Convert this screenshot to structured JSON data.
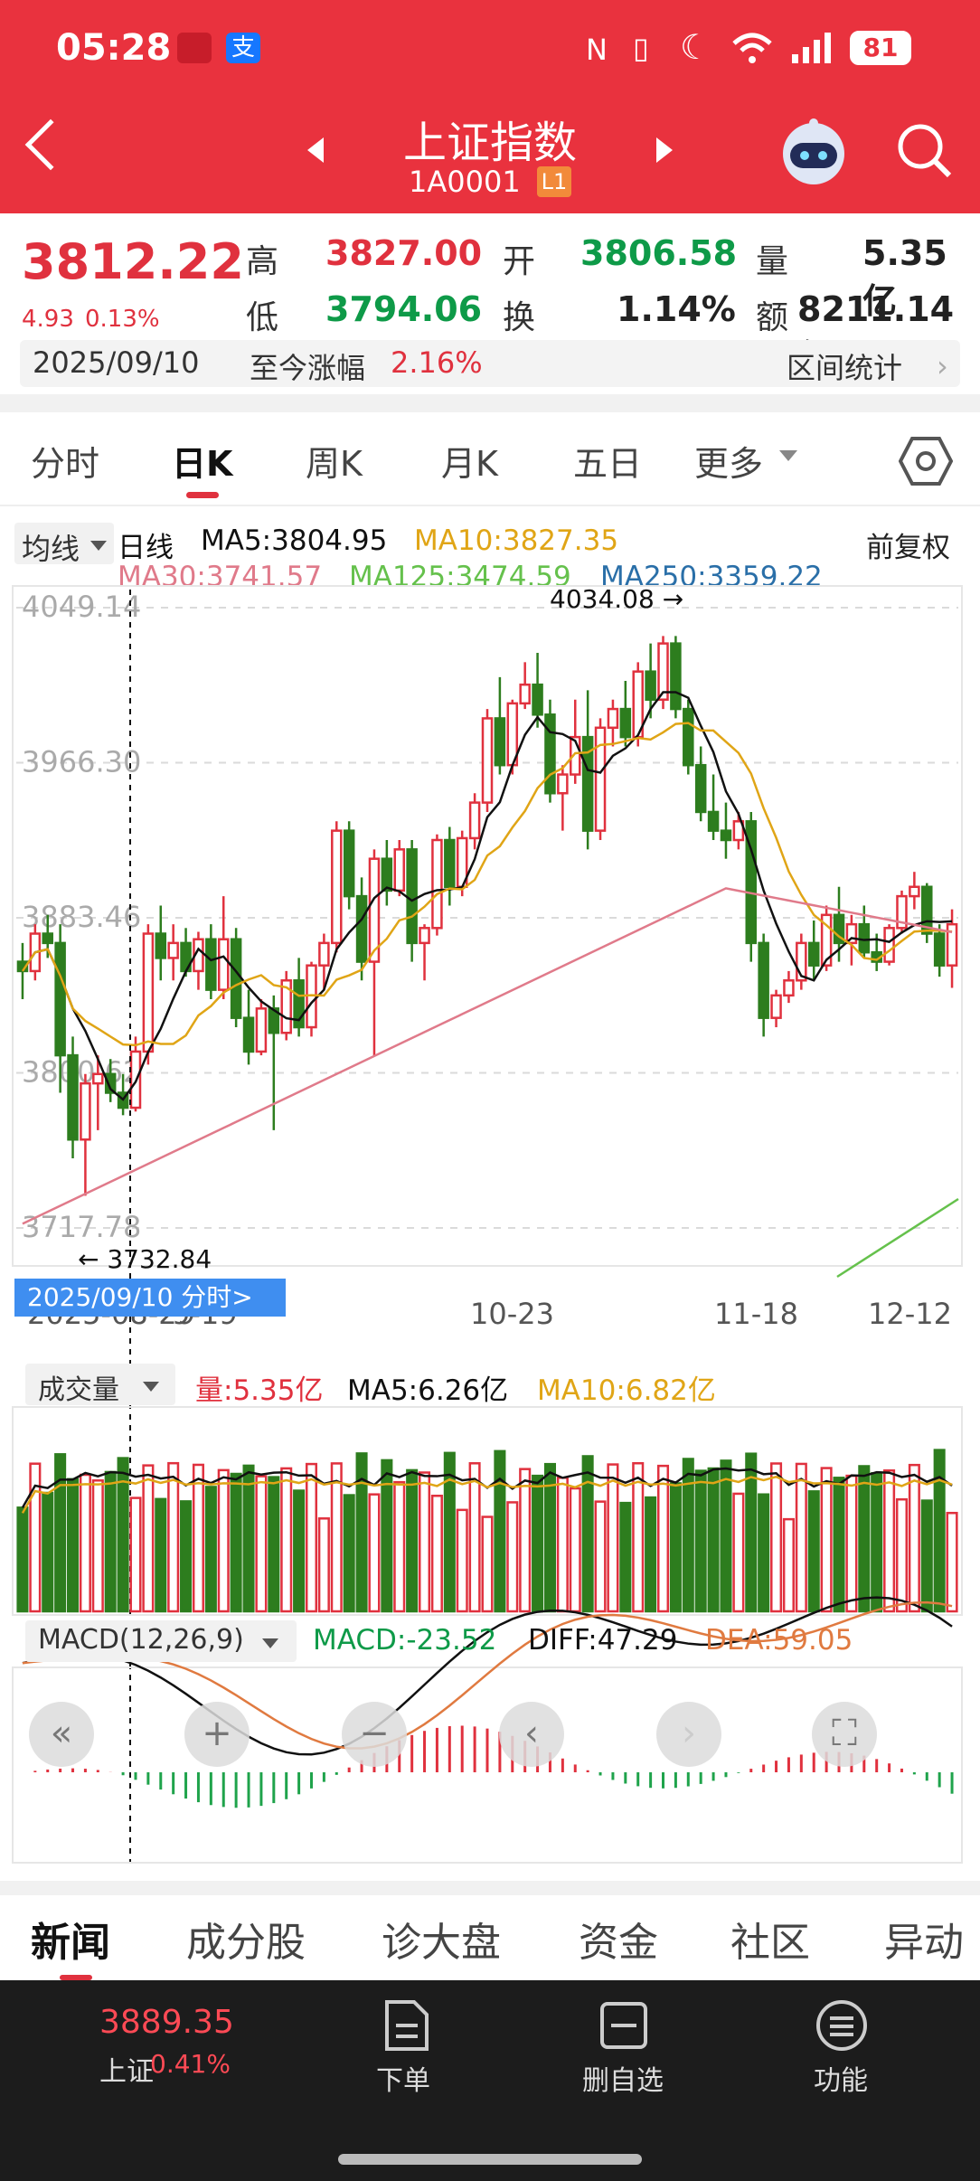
{
  "status_bar": {
    "time": "05:28",
    "battery": "81"
  },
  "header": {
    "title": "上证指数",
    "code": "1A0001",
    "level": "L1"
  },
  "quote": {
    "price": "3812.22",
    "change": "4.93",
    "change_pct": "0.13%",
    "high_label": "高",
    "high": "3827.00",
    "open_label": "开",
    "open": "3806.58",
    "vol_label": "量",
    "volume": "5.35亿",
    "low_label": "低",
    "low": "3794.06",
    "turnover_label": "换",
    "turnover": "1.14%",
    "amount_label": "额",
    "amount": "8211.14亿",
    "date": "2025/09/10",
    "since_label": "至今涨幅",
    "since_value": "2.16%",
    "range_stats": "区间统计"
  },
  "tabs": [
    "分时",
    "日K",
    "周K",
    "月K",
    "五日",
    "更多"
  ],
  "chart_controls": {
    "indicator_select": "均线",
    "period": "日线",
    "adjust": "前复权"
  },
  "ma_legend": {
    "ma5": "MA5:3804.95",
    "ma10": "MA10:3827.35",
    "ma30": "MA30:3741.57",
    "ma125": "MA125:3474.59",
    "ma250": "MA250:3359.22"
  },
  "y_ticks": [
    "4049.14",
    "3966.30",
    "3883.46",
    "3800.62",
    "3717.78"
  ],
  "high_label": "4034.08",
  "low_label": "3732.84",
  "x_ticks": [
    "2025-08-29",
    "9-19",
    "10-23",
    "11-18",
    "12-12"
  ],
  "cursor_label": "2025/09/10 分时>",
  "volume_legend": {
    "select": "成交量",
    "vol": "量:5.35亿",
    "ma5": "MA5:6.26亿",
    "ma10": "MA10:6.82亿"
  },
  "macd_legend": {
    "select": "MACD(12,26,9)",
    "macd": "MACD:-23.52",
    "diff": "DIFF:47.29",
    "dea": "DEA:59.05"
  },
  "news_tabs": [
    "新闻",
    "成分股",
    "诊大盘",
    "资金",
    "社区",
    "异动"
  ],
  "bottom_bar": {
    "index_value": "3889.35",
    "index_label": "上证",
    "index_pct": "0.41%",
    "order": "下单",
    "remove_watch": "删自选",
    "functions": "功能"
  },
  "colors": {
    "up": "#e0313e",
    "down": "#2d7d1e",
    "ma5": "#111111",
    "ma10": "#e0a516",
    "ma30": "#e07a8a",
    "ma125": "#65c14c",
    "ma250": "#2a6fa8",
    "header": "#e9323e"
  },
  "chart_data": {
    "type": "candlestick",
    "ylim": [
      3717.78,
      4049.14
    ],
    "candles": [
      [
        3860,
        3870,
        3840,
        3855
      ],
      [
        3855,
        3880,
        3850,
        3875
      ],
      [
        3875,
        3885,
        3862,
        3870
      ],
      [
        3870,
        3880,
        3790,
        3810
      ],
      [
        3810,
        3820,
        3755,
        3765
      ],
      [
        3765,
        3800,
        3735,
        3795
      ],
      [
        3795,
        3810,
        3770,
        3800
      ],
      [
        3800,
        3808,
        3785,
        3790
      ],
      [
        3790,
        3800,
        3778,
        3782
      ],
      [
        3782,
        3820,
        3780,
        3812
      ],
      [
        3812,
        3880,
        3805,
        3875
      ],
      [
        3875,
        3890,
        3850,
        3862
      ],
      [
        3862,
        3880,
        3850,
        3870
      ],
      [
        3870,
        3878,
        3852,
        3855
      ],
      [
        3855,
        3876,
        3845,
        3872
      ],
      [
        3872,
        3880,
        3840,
        3845
      ],
      [
        3845,
        3895,
        3840,
        3872
      ],
      [
        3872,
        3878,
        3825,
        3830
      ],
      [
        3830,
        3845,
        3805,
        3812
      ],
      [
        3812,
        3840,
        3810,
        3835
      ],
      [
        3835,
        3842,
        3770,
        3822
      ],
      [
        3822,
        3855,
        3818,
        3850
      ],
      [
        3850,
        3862,
        3820,
        3825
      ],
      [
        3825,
        3860,
        3820,
        3858
      ],
      [
        3858,
        3875,
        3845,
        3870
      ],
      [
        3870,
        3935,
        3865,
        3930
      ],
      [
        3930,
        3935,
        3888,
        3895
      ],
      [
        3895,
        3905,
        3850,
        3860
      ],
      [
        3860,
        3920,
        3810,
        3915
      ],
      [
        3915,
        3925,
        3890,
        3898
      ],
      [
        3898,
        3925,
        3895,
        3920
      ],
      [
        3920,
        3925,
        3860,
        3870
      ],
      [
        3870,
        3880,
        3850,
        3878
      ],
      [
        3878,
        3928,
        3874,
        3925
      ],
      [
        3925,
        3932,
        3890,
        3900
      ],
      [
        3900,
        3930,
        3895,
        3926
      ],
      [
        3926,
        3950,
        3920,
        3945
      ],
      [
        3945,
        3995,
        3940,
        3990
      ],
      [
        3990,
        4012,
        3960,
        3965
      ],
      [
        3965,
        4000,
        3960,
        3998
      ],
      [
        3998,
        4020,
        3995,
        4008
      ],
      [
        4008,
        4025,
        3985,
        3992
      ],
      [
        3992,
        4000,
        3945,
        3950
      ],
      [
        3950,
        3965,
        3930,
        3960
      ],
      [
        3960,
        4000,
        3955,
        3980
      ],
      [
        3980,
        4005,
        3920,
        3930
      ],
      [
        3930,
        3990,
        3925,
        3985
      ],
      [
        3985,
        4000,
        3975,
        3995
      ],
      [
        3995,
        4010,
        3975,
        3980
      ],
      [
        3980,
        4020,
        3975,
        4015
      ],
      [
        4015,
        4030,
        3990,
        4000
      ],
      [
        4000,
        4034,
        3995,
        4030
      ],
      [
        4030,
        4034,
        3990,
        3995
      ],
      [
        3995,
        4000,
        3960,
        3965
      ],
      [
        3965,
        3975,
        3935,
        3940
      ],
      [
        3940,
        3960,
        3925,
        3930
      ],
      [
        3930,
        3945,
        3915,
        3925
      ],
      [
        3925,
        3940,
        3920,
        3935
      ],
      [
        3935,
        3940,
        3860,
        3870
      ],
      [
        3870,
        3875,
        3820,
        3830
      ],
      [
        3830,
        3845,
        3825,
        3842
      ],
      [
        3842,
        3855,
        3838,
        3850
      ],
      [
        3850,
        3875,
        3845,
        3870
      ],
      [
        3870,
        3882,
        3850,
        3858
      ],
      [
        3858,
        3890,
        3855,
        3885
      ],
      [
        3885,
        3900,
        3860,
        3870
      ],
      [
        3870,
        3885,
        3858,
        3880
      ],
      [
        3880,
        3890,
        3862,
        3865
      ],
      [
        3865,
        3875,
        3855,
        3860
      ],
      [
        3860,
        3880,
        3858,
        3878
      ],
      [
        3878,
        3898,
        3875,
        3895
      ],
      [
        3895,
        3908,
        3888,
        3900
      ],
      [
        3900,
        3902,
        3870,
        3875
      ],
      [
        3875,
        3880,
        3852,
        3858
      ],
      [
        3858,
        3888,
        3846,
        3880
      ]
    ]
  }
}
